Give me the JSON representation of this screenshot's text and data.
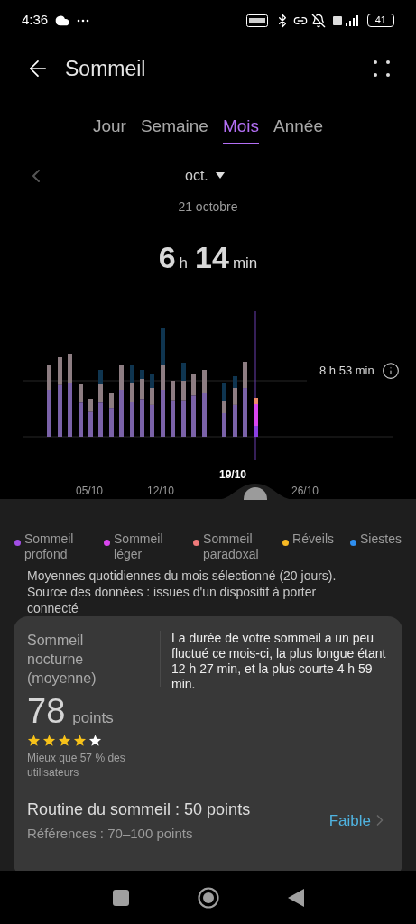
{
  "status_bar": {
    "time": "4:36",
    "battery": "41"
  },
  "header": {
    "title": "Sommeil"
  },
  "tabs": [
    {
      "label": "Jour",
      "selected": false
    },
    {
      "label": "Semaine",
      "selected": false
    },
    {
      "label": "Mois",
      "selected": true
    },
    {
      "label": "Année",
      "selected": false
    }
  ],
  "period": {
    "month": "oct.",
    "date": "21 octobre"
  },
  "duration": {
    "hours": "6",
    "hours_unit": "h",
    "minutes": "14",
    "minutes_unit": "min"
  },
  "chart": {
    "reference_label": "8 h 53 min",
    "x_labels": [
      {
        "label": "05/10",
        "selected": false
      },
      {
        "label": "12/10",
        "selected": false
      },
      {
        "label": "19/10",
        "selected": true
      },
      {
        "label": "26/10",
        "selected": false
      }
    ]
  },
  "legend": [
    {
      "label": "Sommeil profond",
      "color": "#a24ee6"
    },
    {
      "label": "Sommeil léger",
      "color": "#d946ef"
    },
    {
      "label": "Sommeil paradoxal",
      "color": "#f07a7a"
    },
    {
      "label": "Réveils",
      "color": "#f7b924"
    },
    {
      "label": "Siestes",
      "color": "#2f8ff0"
    }
  ],
  "note": "Moyennes quotidiennes du mois sélectionné (20 jours). Source des données : issues d'un dispositif à porter connecté",
  "card": {
    "title": "Sommeil nocturne (moyenne)",
    "score": "78",
    "unit": "points",
    "stars": 4,
    "comparison": "Mieux que 57 % des utilisateurs",
    "summary": "La durée de votre sommeil a un peu fluctué ce mois-ci, la plus longue étant 12 h 27 min, et la plus courte 4 h 59 min.",
    "rows": [
      {
        "title": "Routine du sommeil : 50 points",
        "subtitle": "Références : 70–100 points",
        "rating": "Faible"
      }
    ]
  }
}
